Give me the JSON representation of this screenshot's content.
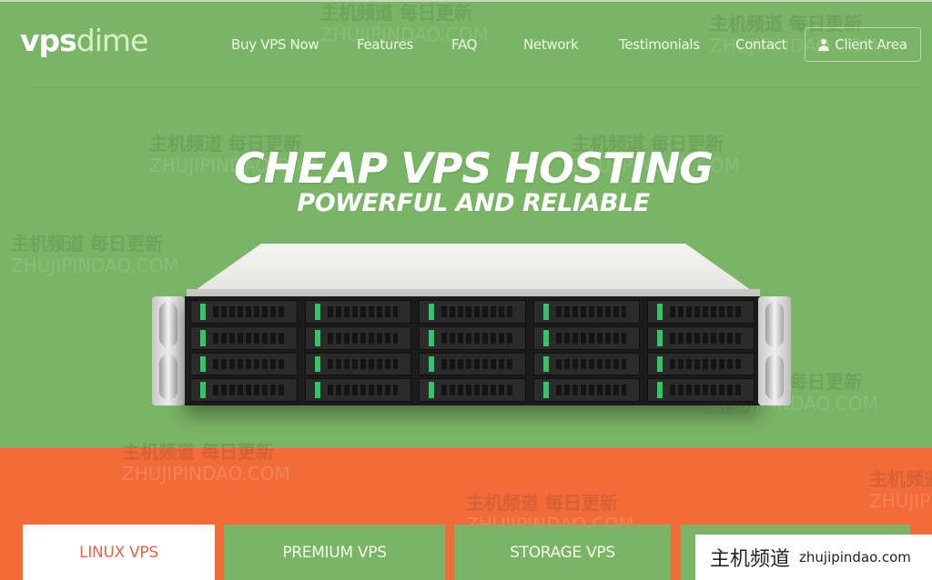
{
  "brand": {
    "logo_part1": "vps",
    "logo_part2": "dime"
  },
  "nav": {
    "items": [
      {
        "label": "Buy VPS Now"
      },
      {
        "label": "Features"
      },
      {
        "label": "FAQ"
      },
      {
        "label": "Network"
      },
      {
        "label": "Testimonials"
      },
      {
        "label": "Contact"
      }
    ],
    "client_area": {
      "label": "Client Area",
      "icon": "user-icon"
    }
  },
  "hero": {
    "title": "CHEAP VPS HOSTING",
    "subtitle": "POWERFUL AND RELIABLE",
    "image": "rack-server"
  },
  "plans": {
    "tabs": [
      {
        "label": "LINUX VPS",
        "active": true
      },
      {
        "label": "PREMIUM VPS",
        "active": false
      },
      {
        "label": "STORAGE VPS",
        "active": false
      },
      {
        "label": "",
        "active": false
      }
    ]
  },
  "watermark": {
    "cn": "主机频道",
    "cn_full": "主机频道 每日更新",
    "en": "zhujipindao.com",
    "en_upper": "ZHUJIPINDAO.COM"
  },
  "colors": {
    "green": "#7ab466",
    "orange": "#f26c3a",
    "active_tab_text": "#e2664a"
  }
}
